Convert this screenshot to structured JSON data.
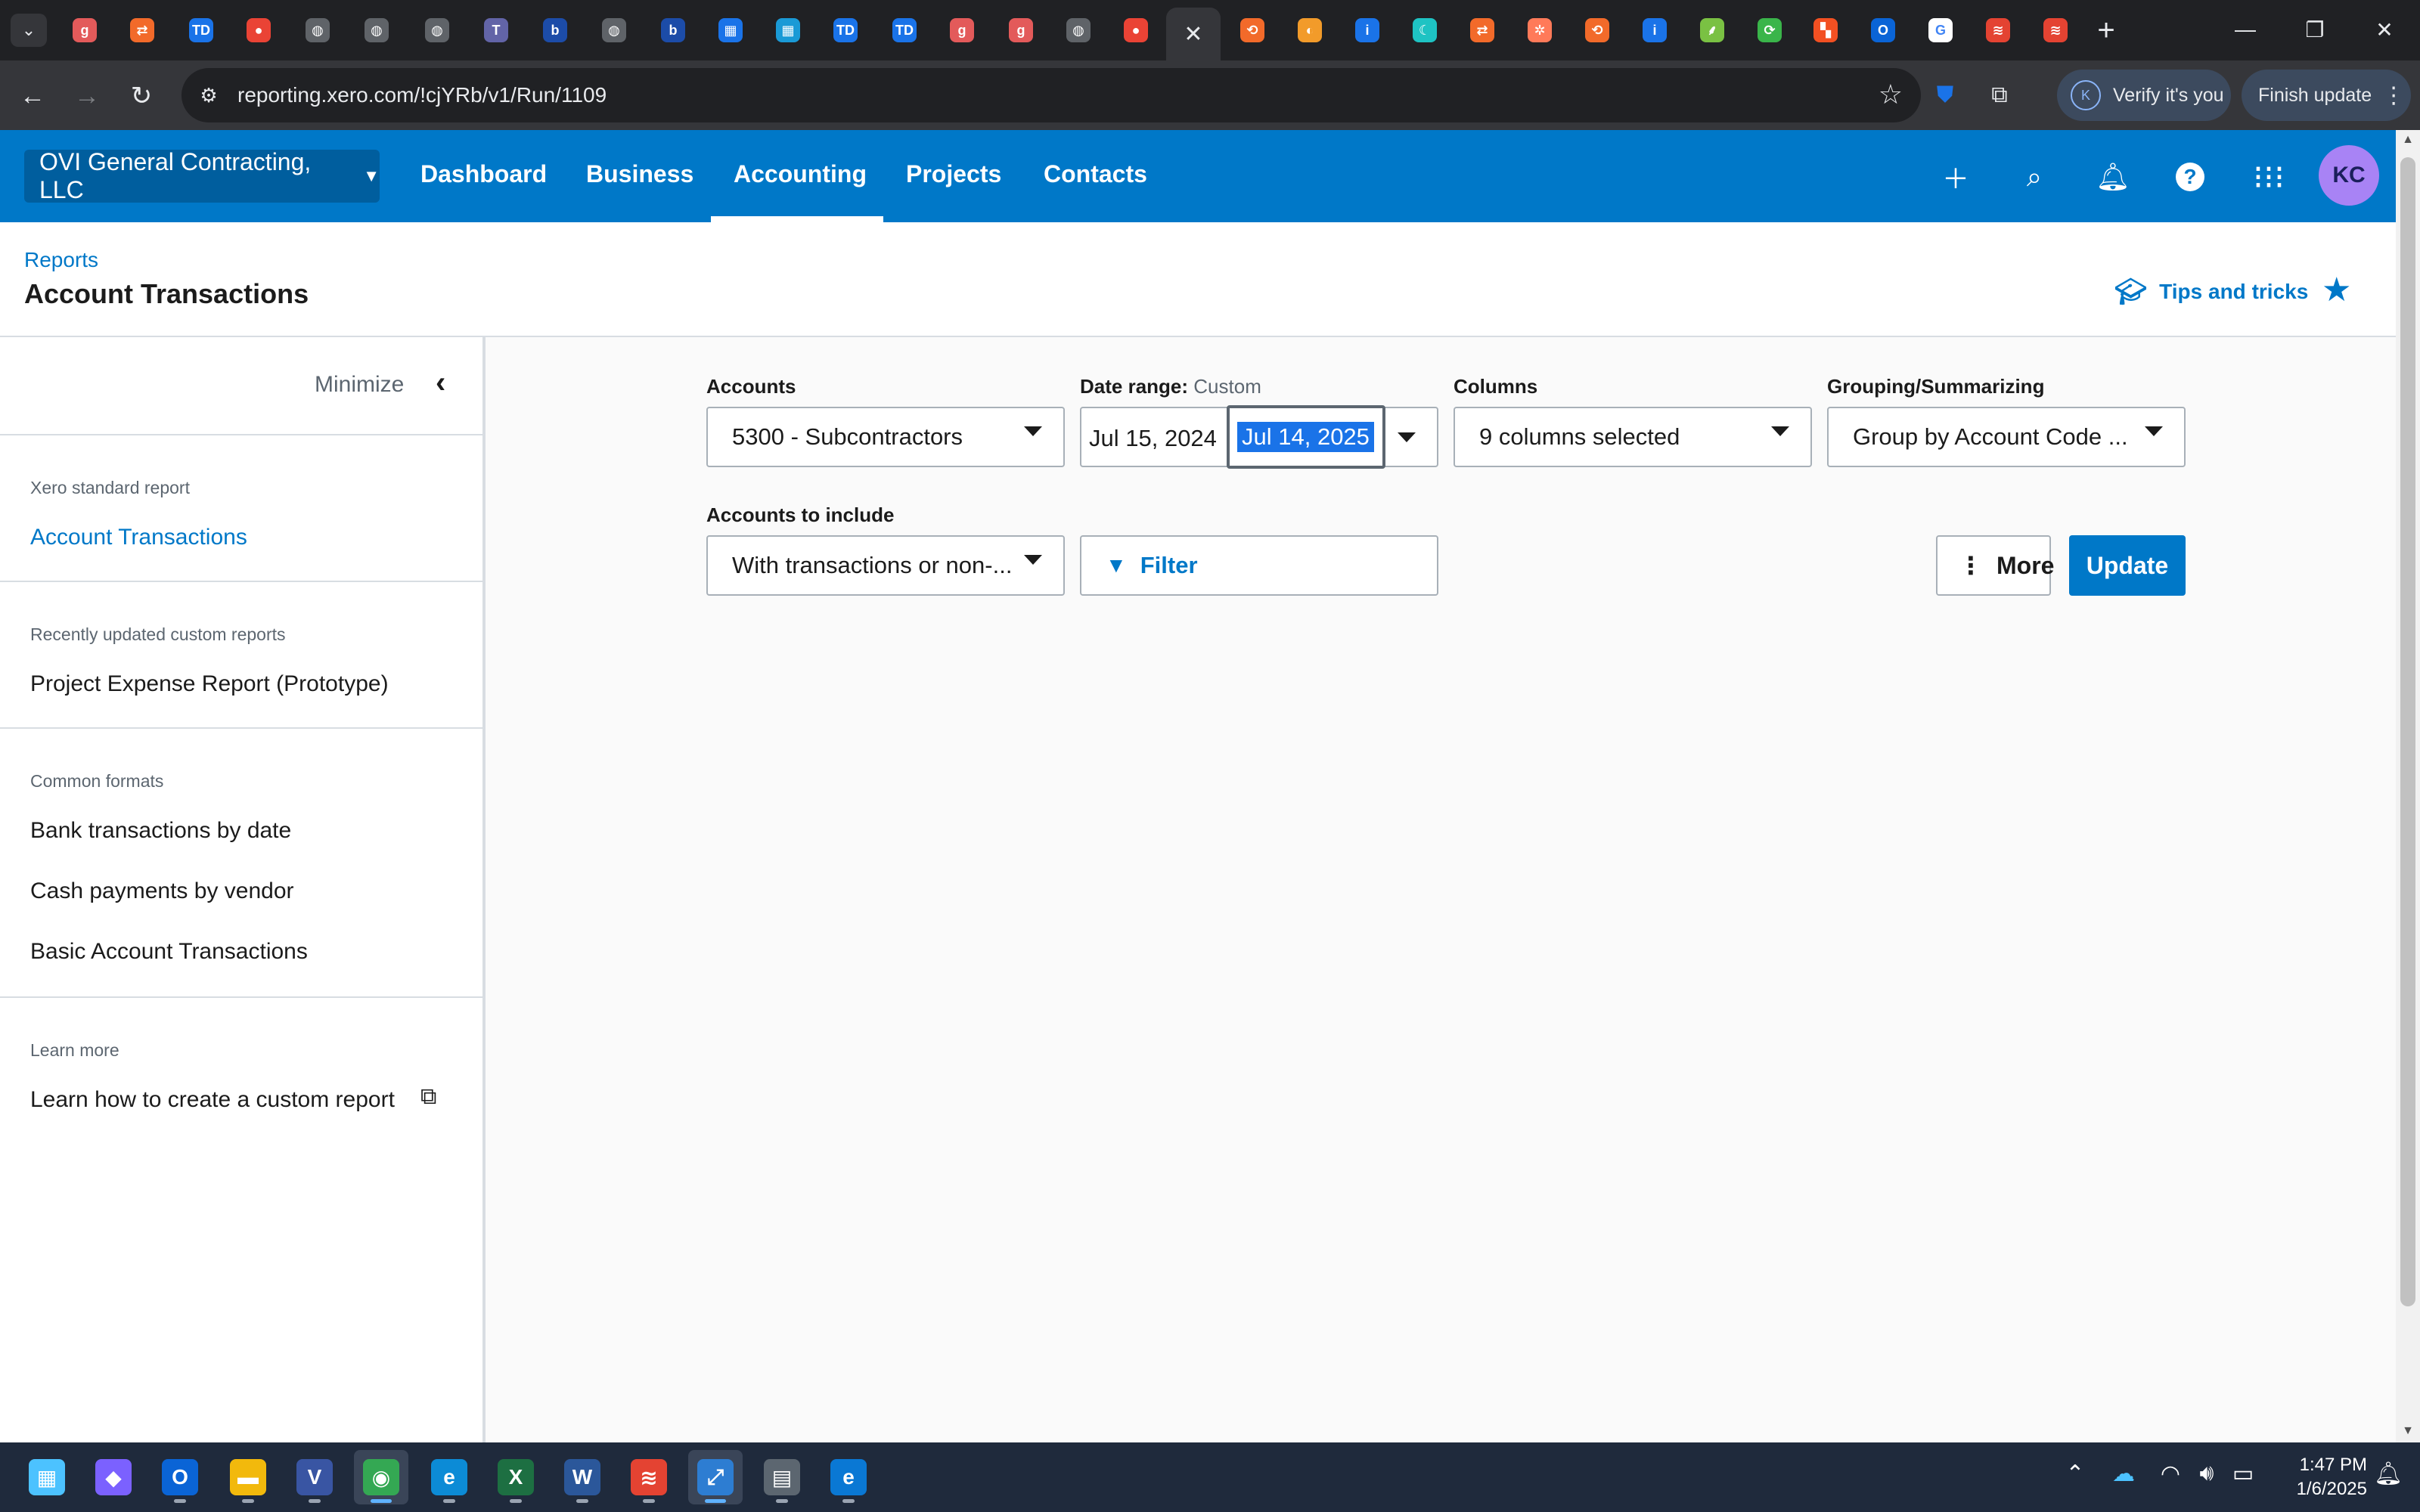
{
  "browser": {
    "tabs": [
      {
        "icon": "grammarly-icon",
        "color": "#e35a5a",
        "glyph": "g"
      },
      {
        "icon": "hubspot-flow-icon",
        "color": "#f26a2a",
        "glyph": "⇄"
      },
      {
        "icon": "td-icon",
        "color": "#1a73e8",
        "glyph": "TD"
      },
      {
        "icon": "record-icon",
        "color": "#ea4335",
        "glyph": "●"
      },
      {
        "icon": "globe-icon",
        "color": "#5f6368",
        "glyph": "◍"
      },
      {
        "icon": "globe-icon",
        "color": "#5f6368",
        "glyph": "◍"
      },
      {
        "icon": "globe-icon",
        "color": "#5f6368",
        "glyph": "◍"
      },
      {
        "icon": "teams-icon",
        "color": "#6264a7",
        "glyph": "T"
      },
      {
        "icon": "bold-b-icon",
        "color": "#1c4ca8",
        "glyph": "b"
      },
      {
        "icon": "globe-icon",
        "color": "#5f6368",
        "glyph": "◍"
      },
      {
        "icon": "bold-b-icon",
        "color": "#1c4ca8",
        "glyph": "b"
      },
      {
        "icon": "grid-apps-icon",
        "color": "#1a73e8",
        "glyph": "▦"
      },
      {
        "icon": "grid-apps-icon",
        "color": "#1a9ad6",
        "glyph": "▦"
      },
      {
        "icon": "td-icon",
        "color": "#1a73e8",
        "glyph": "TD"
      },
      {
        "icon": "td-icon",
        "color": "#1a73e8",
        "glyph": "TD"
      },
      {
        "icon": "grammarly-icon",
        "color": "#e35a5a",
        "glyph": "g"
      },
      {
        "icon": "grammarly-icon",
        "color": "#e35a5a",
        "glyph": "g"
      },
      {
        "icon": "globe-icon",
        "color": "#5f6368",
        "glyph": "◍"
      },
      {
        "icon": "record-icon",
        "color": "#ea4335",
        "glyph": "●"
      },
      {
        "icon": "close-icon",
        "color": "#35363a",
        "glyph": "✕",
        "active": true
      },
      {
        "icon": "swirl-icon",
        "color": "#f26a2a",
        "glyph": "⟲"
      },
      {
        "icon": "chart-icon",
        "color": "#f29b2a",
        "glyph": "◐"
      },
      {
        "icon": "info-icon",
        "color": "#1a73e8",
        "glyph": "i"
      },
      {
        "icon": "crescent-icon",
        "color": "#1ec3c3",
        "glyph": "☾"
      },
      {
        "icon": "hubspot-flow-icon",
        "color": "#f26a2a",
        "glyph": "⇄"
      },
      {
        "icon": "hubspot-icon",
        "color": "#ff7a59",
        "glyph": "✲"
      },
      {
        "icon": "swirl-icon",
        "color": "#f26a2a",
        "glyph": "⟲"
      },
      {
        "icon": "info-icon",
        "color": "#1a73e8",
        "glyph": "i"
      },
      {
        "icon": "leaf-icon",
        "color": "#7ac143",
        "glyph": "⸙"
      },
      {
        "icon": "sync-icon",
        "color": "#3ab54a",
        "glyph": "⟳"
      },
      {
        "icon": "microsoft-icon",
        "color": "#f25022",
        "glyph": "▚"
      },
      {
        "icon": "outlook-icon",
        "color": "#0a64d6",
        "glyph": "O"
      },
      {
        "icon": "google-icon",
        "color": "#ffffff",
        "glyph": "G"
      },
      {
        "icon": "todoist-icon",
        "color": "#e44332",
        "glyph": "≋"
      },
      {
        "icon": "todoist-icon",
        "color": "#e44332",
        "glyph": "≋"
      }
    ],
    "url": "reporting.xero.com/!cjYRb/v1/Run/1109",
    "verify_label": "Verify it's you",
    "verify_badge": "K",
    "finish_update_label": "Finish update"
  },
  "xero": {
    "org_name": "OVI General Contracting, LLC",
    "nav": [
      "Dashboard",
      "Business",
      "Accounting",
      "Projects",
      "Contacts"
    ],
    "active_nav": "Accounting",
    "avatar_initials": "KC",
    "accent_color": "#0078c8"
  },
  "page": {
    "breadcrumb": "Reports",
    "title": "Account Transactions",
    "tips_label": "Tips and tricks"
  },
  "sidebar": {
    "minimize_label": "Minimize",
    "sections": {
      "standard": {
        "heading": "Xero standard report",
        "item": "Account Transactions"
      },
      "recent": {
        "heading": "Recently updated custom reports",
        "item": "Project Expense Report (Prototype)"
      },
      "common": {
        "heading": "Common formats",
        "items": [
          "Bank transactions by date",
          "Cash payments by vendor",
          "Basic Account Transactions"
        ]
      },
      "learn": {
        "heading": "Learn more",
        "item": "Learn how to create a custom report"
      }
    }
  },
  "settings": {
    "accounts": {
      "label": "Accounts",
      "value": "5300 - Subcontractors"
    },
    "date_range": {
      "label": "Date range:",
      "mode": "Custom",
      "from": "Jul 15, 2024",
      "to": "Jul 14, 2025"
    },
    "columns": {
      "label": "Columns",
      "value": "9 columns selected"
    },
    "grouping": {
      "label": "Grouping/Summarizing",
      "value": "Group by Account Code ..."
    },
    "accounts_to_include": {
      "label": "Accounts to include",
      "value": "With transactions or non-..."
    },
    "filter_label": "Filter",
    "more_label": "More",
    "update_label": "Update"
  },
  "taskbar": {
    "apps": [
      {
        "icon": "windows-start-icon",
        "color": "#4cc2ff",
        "glyph": "▦"
      },
      {
        "icon": "copilot-icon",
        "color": "#7b61ff",
        "glyph": "◆"
      },
      {
        "icon": "outlook-icon",
        "color": "#0a64d6",
        "glyph": "O"
      },
      {
        "icon": "file-explorer-icon",
        "color": "#f2b90c",
        "glyph": "▬"
      },
      {
        "icon": "visio-icon",
        "color": "#3955a3",
        "glyph": "V"
      },
      {
        "icon": "chrome-icon",
        "color": "#34a853",
        "glyph": "◉",
        "active": true
      },
      {
        "icon": "edge-icon",
        "color": "#0c8bd6",
        "glyph": "e"
      },
      {
        "icon": "excel-icon",
        "color": "#1d6f42",
        "glyph": "X"
      },
      {
        "icon": "word-icon",
        "color": "#2b579a",
        "glyph": "W"
      },
      {
        "icon": "todoist-icon",
        "color": "#e44332",
        "glyph": "≋"
      },
      {
        "icon": "remote-desktop-icon",
        "color": "#2d7dd2",
        "glyph": "⤢",
        "active": true
      },
      {
        "icon": "calculator-icon",
        "color": "#5c6670",
        "glyph": "▤"
      },
      {
        "icon": "edge-dev-icon",
        "color": "#0a78d4",
        "glyph": "e"
      }
    ],
    "time": "1:47 PM",
    "date": "1/6/2025"
  }
}
